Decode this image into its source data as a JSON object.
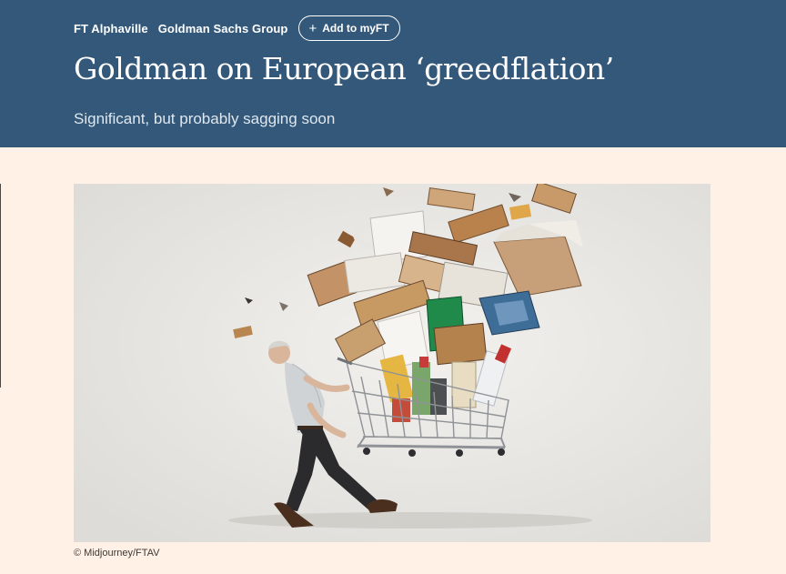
{
  "header": {
    "breadcrumb": [
      "FT Alphaville",
      "Goldman Sachs Group"
    ],
    "add_button": {
      "icon": "plus-icon",
      "label": "Add to myFT"
    },
    "title": "Goldman on European ‘greedflation’",
    "standfirst": "Significant, but probably sagging soon"
  },
  "colors": {
    "header_bg": "#33587a",
    "page_bg": "#fff1e5",
    "text_on_header": "#ffffff"
  },
  "image": {
    "alt": "Man pushing an overloaded shopping trolley",
    "caption": "© Midjourney/FTAV"
  }
}
